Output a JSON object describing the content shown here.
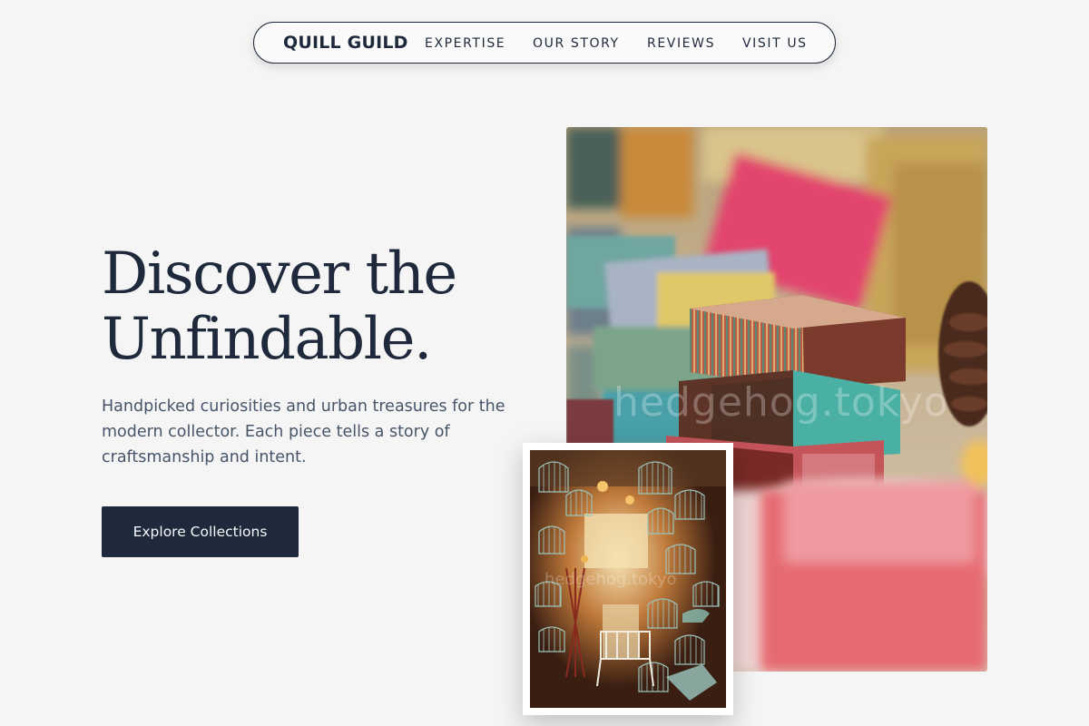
{
  "nav": {
    "brand": "QUILL GUILD",
    "links": [
      {
        "label": "EXPERTISE"
      },
      {
        "label": "OUR STORY"
      },
      {
        "label": "REVIEWS"
      },
      {
        "label": "VISIT US"
      }
    ]
  },
  "hero": {
    "title_line1": "Discover the",
    "title_line2": "Unfindable.",
    "description": "Handpicked curiosities and urban treasures for the modern collector. Each piece tells a story of craftsmanship and intent.",
    "cta_label": "Explore Collections"
  },
  "images": {
    "main_watermark": "hedgehog.tokyo",
    "inset_watermark": "hedgehog.tokyo"
  },
  "colors": {
    "background": "#f5f5f5",
    "ink": "#1e293b",
    "body_text": "#475569",
    "button_bg": "#1e293b",
    "button_text": "#f8fafc"
  }
}
